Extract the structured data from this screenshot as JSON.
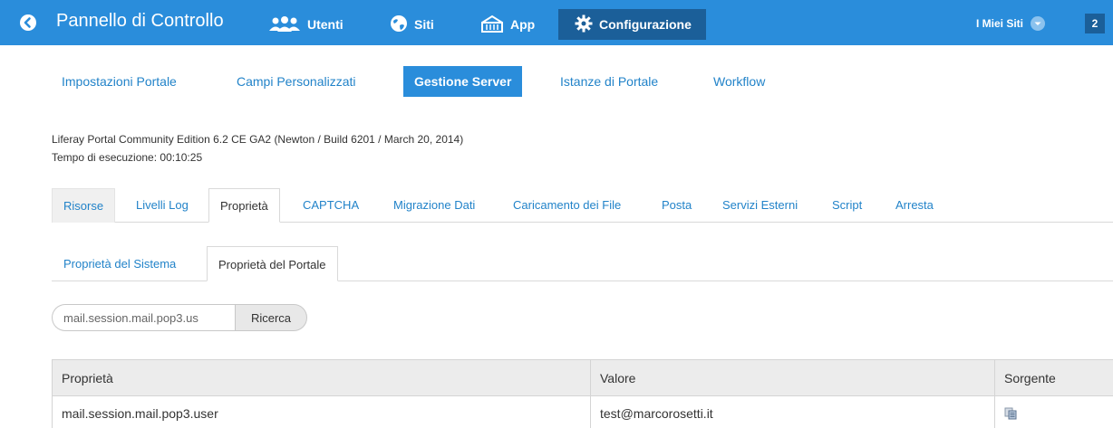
{
  "topbar": {
    "title": "Pannello di Controllo",
    "nav": [
      {
        "label": "Utenti",
        "icon": "users-icon"
      },
      {
        "label": "Siti",
        "icon": "globe-icon"
      },
      {
        "label": "App",
        "icon": "basket-icon"
      },
      {
        "label": "Configurazione",
        "icon": "gear-icon",
        "active": true
      }
    ],
    "my_sites": "I Miei Siti",
    "notifications": "2",
    "color": "#2a8ddb",
    "active_color": "#1b5f99"
  },
  "admin_tabs": [
    {
      "label": "Impostazioni Portale"
    },
    {
      "label": "Campi Personalizzati"
    },
    {
      "label": "Gestione Server",
      "active": true
    },
    {
      "label": "Istanze di Portale"
    },
    {
      "label": "Workflow"
    }
  ],
  "info": {
    "version": "Liferay Portal Community Edition 6.2 CE GA2 (Newton / Build 6201 / March 20, 2014)",
    "uptime": "Tempo di esecuzione: 00:10:25"
  },
  "server_tabs": [
    {
      "label": "Risorse"
    },
    {
      "label": "Livelli Log"
    },
    {
      "label": "Proprietà",
      "active": true
    },
    {
      "label": "CAPTCHA"
    },
    {
      "label": "Migrazione Dati"
    },
    {
      "label": "Caricamento dei File"
    },
    {
      "label": "Posta"
    },
    {
      "label": "Servizi Esterni"
    },
    {
      "label": "Script"
    },
    {
      "label": "Arresta"
    }
  ],
  "property_tabs": [
    {
      "label": "Proprietà del Sistema"
    },
    {
      "label": "Proprietà del Portale",
      "active": true
    }
  ],
  "search": {
    "value": "mail.session.mail.pop3.us",
    "button": "Ricerca"
  },
  "table": {
    "headers": [
      "Proprietà",
      "Valore",
      "Sorgente"
    ],
    "rows": [
      {
        "property": "mail.session.mail.pop3.user",
        "value": "test@marcorosetti.it",
        "source_icon": "copy-icon"
      }
    ]
  }
}
